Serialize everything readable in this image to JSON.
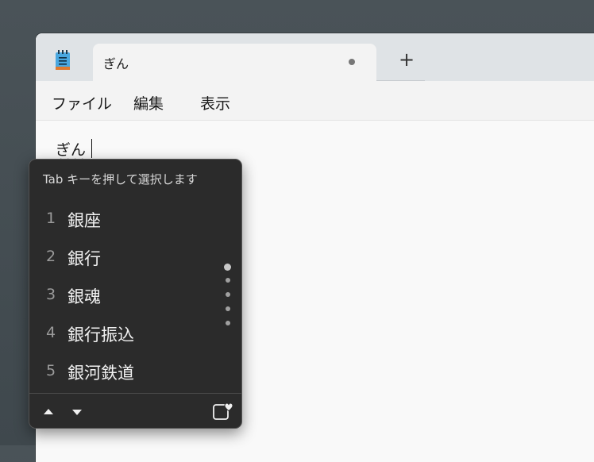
{
  "tab": {
    "title": "ぎん",
    "new_tab_symbol": "+"
  },
  "menu": {
    "file": "ファイル",
    "edit": "編集",
    "view": "表示"
  },
  "editor": {
    "composition": "ぎん"
  },
  "ime": {
    "hint": "Tab キーを押して選択します",
    "candidates": [
      {
        "num": "1",
        "text": "銀座"
      },
      {
        "num": "2",
        "text": "銀行"
      },
      {
        "num": "3",
        "text": "銀魂"
      },
      {
        "num": "4",
        "text": "銀行振込"
      },
      {
        "num": "5",
        "text": "銀河鉄道"
      }
    ],
    "pager": {
      "pages": 5,
      "current_page": 1
    },
    "icons": {
      "prev": "triangle-up-icon",
      "next": "triangle-down-icon",
      "favorite": "heart-clipboard-icon"
    }
  }
}
